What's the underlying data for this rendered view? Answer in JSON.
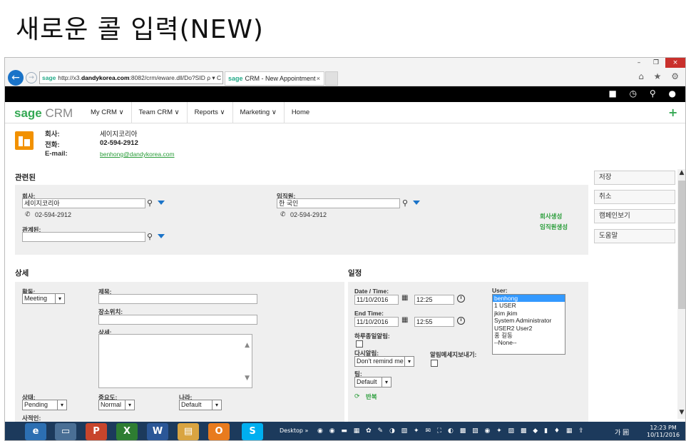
{
  "slide_title": "새로운 콜 입력(NEW)",
  "browser": {
    "address_prefix": "http://x3.",
    "address_domain": "dandykorea.com",
    "address_suffix": ":8082/crm/eware.dll/Do?SID",
    "address_tools": "ρ ▾ C",
    "site_badge": "sage",
    "tab_label": "CRM - New Appointment",
    "tab_close": "×",
    "window_buttons": [
      "–",
      "❐",
      "×"
    ],
    "right_icons": "⌂ ★ ⚙",
    "topbar_icons": "■ ◷ ⚲ ●"
  },
  "crm": {
    "logo_sage": "sage",
    "logo_crm": " CRM",
    "nav": [
      "My CRM ∨",
      "Team CRM ∨",
      "Reports ∨",
      "Marketing ∨",
      "Home"
    ],
    "plus_icon": "+"
  },
  "company": {
    "company_label": "회사:",
    "company_value": "세이지코리아",
    "phone_label": "전화:",
    "phone_value": "02-594-2912",
    "email_label": "E-mail:",
    "email_value": "benhong@dandykorea.com"
  },
  "related": {
    "heading": "관련된",
    "company_label": "회사:",
    "company_input": "세이지코리아",
    "company_phone": "02-594-2912",
    "person_label": "임직원:",
    "person_input": "한 국인",
    "person_phone": "02-594-2912",
    "relation_label": "관계된:",
    "create_company": "회사생성",
    "create_person": "임직원생성",
    "phone_glyph": "✆",
    "search_glyph": "⚲"
  },
  "details": {
    "heading": "상세",
    "activity_label": "활동:",
    "activity_value": "Meeting",
    "subject_label": "제목:",
    "location_label": "장소위치:",
    "detail_label": "상세:",
    "status_label": "상태:",
    "status_value": "Pending",
    "priority_label": "중요도:",
    "priority_value": "Normal",
    "country_label": "나라:",
    "country_value": "Default",
    "private_label": "사적인:",
    "select_arrow": "▾",
    "ta_up": "▲",
    "ta_down": "▼"
  },
  "schedule": {
    "heading": "일정",
    "datetime_label": "Date / Time:",
    "start_date": "11/10/2016",
    "start_time": "12:25",
    "endtime_label": "End Time:",
    "end_date": "11/10/2016",
    "end_time": "12:55",
    "allday_label": "하루종일알림:",
    "remind_label": "다시알림:",
    "remind_value": "Don't remind me",
    "sendmsg_label": "알림메세지보내기:",
    "team_label": "팀:",
    "team_value": "Default",
    "repeat_label": "반복",
    "cal_glyph": "▦",
    "repeat_glyph": "⟳",
    "user_label": "User:",
    "users": [
      "benhong",
      "1 USER",
      "jkim jkim",
      "System Administrator",
      "USER2 User2",
      "홍 길동",
      "--None--"
    ]
  },
  "sidebar_buttons": [
    "저장",
    "취소",
    "캠페인보기",
    "도움말"
  ],
  "scroll": {
    "up": "▲",
    "down": "▼"
  },
  "taskbar": {
    "apps": [
      "e",
      "▭",
      "P",
      "X",
      "W",
      "▤",
      "O",
      "S"
    ],
    "desktop_label": "Desktop »",
    "tray_icons": "◉ ◉ ▬ ▦ ✿ ✎ ◑ ▧ ✦ ✉ ⛶ ◐ ▩ ▧ ◉ ✦ ▨ ▩ ◆ ▮ ♦ ▦ ⇪",
    "ime": "가 囲",
    "time": "12:23 PM",
    "date": "10/11/2016"
  },
  "colors": {
    "accent_blue": "#1a73c8",
    "sage_green": "#34a853",
    "company_orange": "#f29100",
    "taskbar": "#1c3a5c",
    "selected": "#3399ff"
  }
}
